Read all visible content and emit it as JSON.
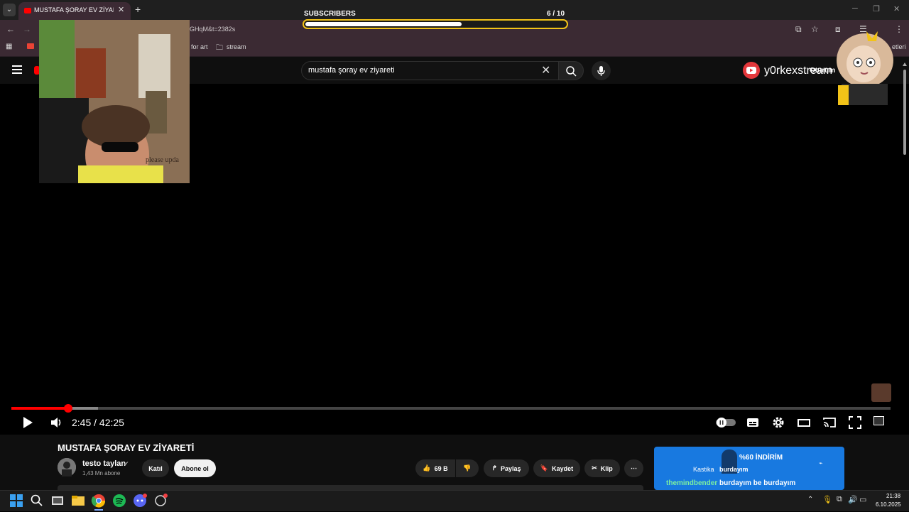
{
  "browser": {
    "tab_title": "MUSTAFA ŞORAY EV ZİYARETİ -",
    "url_fragment": "GHqM&t=2382s",
    "bookmarks": [
      "for art",
      "stream"
    ],
    "bookmarks_overflow": "etleri"
  },
  "overlay": {
    "subscribers_label": "SUBSCRIBERS",
    "subscribers_count": "6  / 10",
    "subscribers_progress": 0.6,
    "stream_name": "y0rkexstream",
    "webcam_caption": "please upda"
  },
  "youtube": {
    "search_query": "mustafa şoray ev ziyareti",
    "sign_in": "Oturum",
    "player": {
      "time": "2:45 / 42:25",
      "played_fraction": 0.0649,
      "buffered_fraction": 0.0985
    },
    "video": {
      "title": "MUSTAFA ŞORAY EV ZİYARETİ",
      "channel_name": "testo taylan",
      "channel_subs": "1,43 Mn abone",
      "join_label": "Katıl",
      "subscribe_label": "Abone ol",
      "like_count": "69 B",
      "share_label": "Paylaş",
      "save_label": "Kaydet",
      "clip_label": "Klip"
    }
  },
  "ad": {
    "discount": "%60 İNDİRİM",
    "brand": "Kastika",
    "tagline": "burdayım"
  },
  "chat": {
    "username": "themindbender",
    "message": "burdayım be burdayım"
  },
  "taskbar": {
    "time": "21:38",
    "date": "6.10.2025"
  },
  "colors": {
    "yt_red": "#ff0000",
    "sub_bar_border": "#f2c318",
    "chat_name": "#7cf0a1",
    "ad_blue": "#1879e0"
  }
}
